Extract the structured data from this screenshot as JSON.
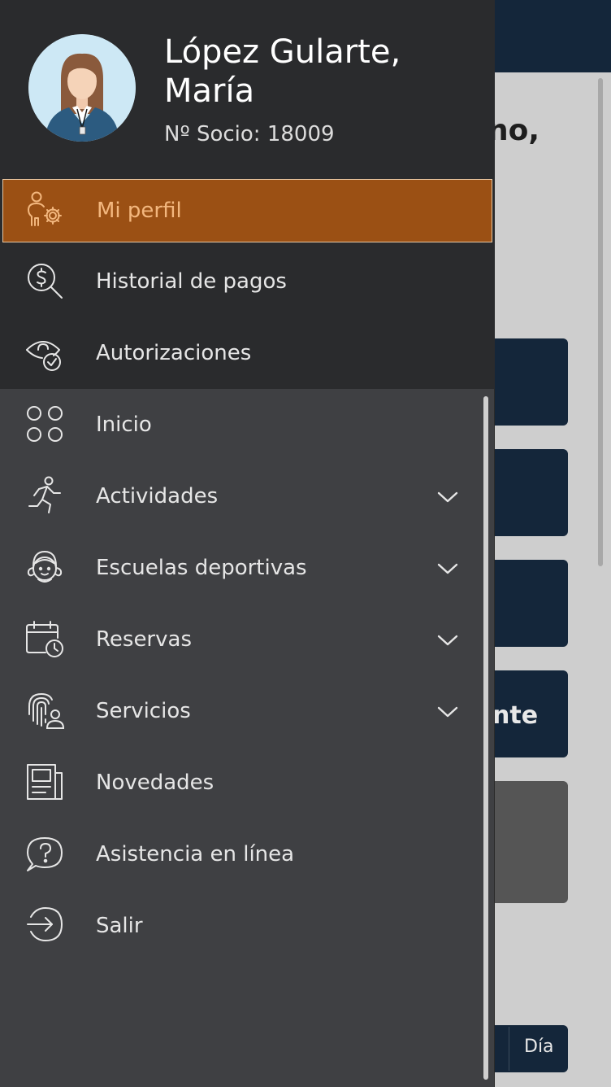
{
  "background": {
    "greeting_fragment": "no,",
    "card_fragment": "nte",
    "view_button": "Día"
  },
  "user": {
    "name_line1": "López Gularte,",
    "name_line2": "María",
    "member_number": "Nº Socio: 18009",
    "avatar": "female-user-avatar"
  },
  "account_menu": [
    {
      "label": "Mi perfil",
      "icon": "profile-settings-icon",
      "active": true
    },
    {
      "label": "Historial de pagos",
      "icon": "payment-search-icon"
    },
    {
      "label": "Autorizaciones",
      "icon": "eye-check-icon"
    }
  ],
  "main_menu": [
    {
      "label": "Inicio",
      "icon": "grid-circles-icon"
    },
    {
      "label": "Actividades",
      "icon": "running-person-icon",
      "expandable": true
    },
    {
      "label": "Escuelas deportivas",
      "icon": "child-face-icon",
      "expandable": true
    },
    {
      "label": "Reservas",
      "icon": "calendar-clock-icon",
      "expandable": true
    },
    {
      "label": "Servicios",
      "icon": "fingerprint-user-icon",
      "expandable": true
    },
    {
      "label": "Novedades",
      "icon": "newspaper-icon"
    },
    {
      "label": "Asistencia en línea",
      "icon": "help-chat-icon"
    },
    {
      "label": "Salir",
      "icon": "logout-icon"
    }
  ],
  "colors": {
    "drawer_top": "#2a2b2d",
    "drawer_body": "#3f4043",
    "active_item": "#9b5014",
    "active_text": "#f3b77e",
    "header_bg": "#14263a"
  }
}
